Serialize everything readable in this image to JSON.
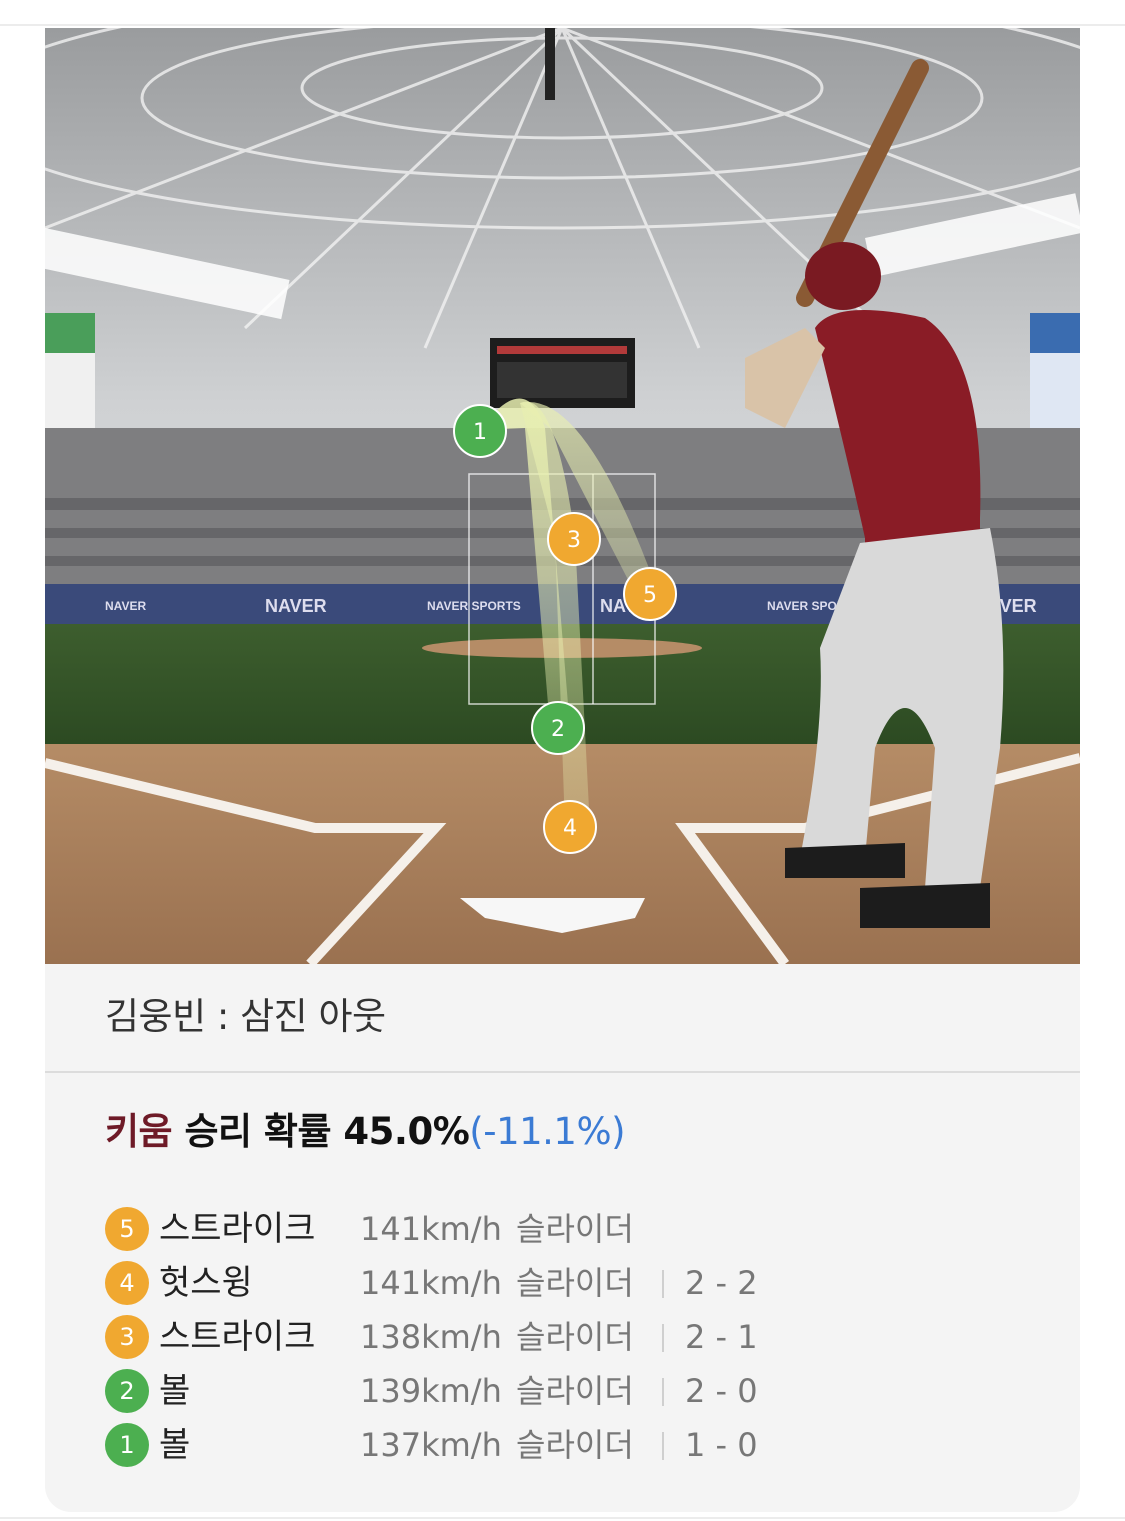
{
  "scene": {
    "banner_texts": [
      "NAVER",
      "NAVER",
      "NAVER",
      "NAVER SPORTS",
      "NAVER SPORTS",
      "NAVER"
    ],
    "markers": [
      {
        "num": "1",
        "result": "볼",
        "color": "#4caf50"
      },
      {
        "num": "2",
        "result": "볼",
        "color": "#4caf50"
      },
      {
        "num": "3",
        "result": "스트라이크",
        "color": "#f0a830"
      },
      {
        "num": "4",
        "result": "헛스윙",
        "color": "#f0a830"
      },
      {
        "num": "5",
        "result": "스트라이크",
        "color": "#f0a830"
      }
    ]
  },
  "play_result": "김웅빈 : 삼진 아웃",
  "win_probability": {
    "team": "키움",
    "label": " 승리 확률 ",
    "value": "45.0%",
    "delta": "(-11.1%)",
    "team_color": "#6e1a27",
    "delta_color": "#3b7bd4"
  },
  "pitches": [
    {
      "num": "5",
      "result": "스트라이크",
      "speed": "141km/h",
      "type": "슬라이더",
      "count": "",
      "badge_color": "orange"
    },
    {
      "num": "4",
      "result": "헛스윙",
      "speed": "141km/h",
      "type": "슬라이더",
      "count": "2 - 2",
      "badge_color": "orange"
    },
    {
      "num": "3",
      "result": "스트라이크",
      "speed": "138km/h",
      "type": "슬라이더",
      "count": "2 - 1",
      "badge_color": "orange"
    },
    {
      "num": "2",
      "result": "볼",
      "speed": "139km/h",
      "type": "슬라이더",
      "count": "2 - 0",
      "badge_color": "green"
    },
    {
      "num": "1",
      "result": "볼",
      "speed": "137km/h",
      "type": "슬라이더",
      "count": "1 - 0",
      "badge_color": "green"
    }
  ]
}
